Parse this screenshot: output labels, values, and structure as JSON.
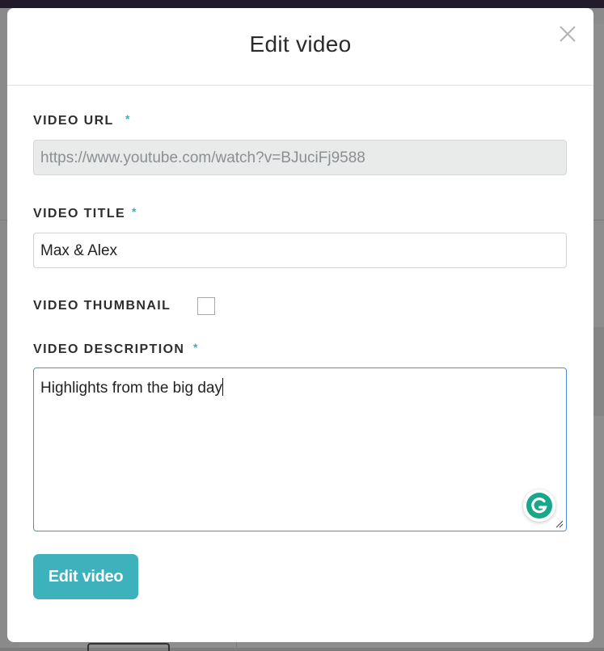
{
  "modal": {
    "title": "Edit video",
    "close_icon": "close-icon"
  },
  "fields": {
    "video_url": {
      "label": "VIDEO URL",
      "required_mark": "*",
      "value": "https://www.youtube.com/watch?v=BJuciFj9588",
      "disabled": true
    },
    "video_title": {
      "label": "VIDEO TITLE",
      "required_mark": "*",
      "value": "Max & Alex"
    },
    "video_thumbnail": {
      "label": "VIDEO THUMBNAIL",
      "checked": false
    },
    "video_description": {
      "label": "VIDEO DESCRIPTION",
      "required_mark": "*",
      "value": "Highlights from the big day"
    }
  },
  "submit": {
    "label": "Edit video"
  },
  "colors": {
    "accent": "#3db1bc",
    "required": "#3aaeb8",
    "grammarly": "#15a88a"
  },
  "icons": {
    "grammarly": "grammarly-icon",
    "resize": "resize-handle-icon"
  }
}
